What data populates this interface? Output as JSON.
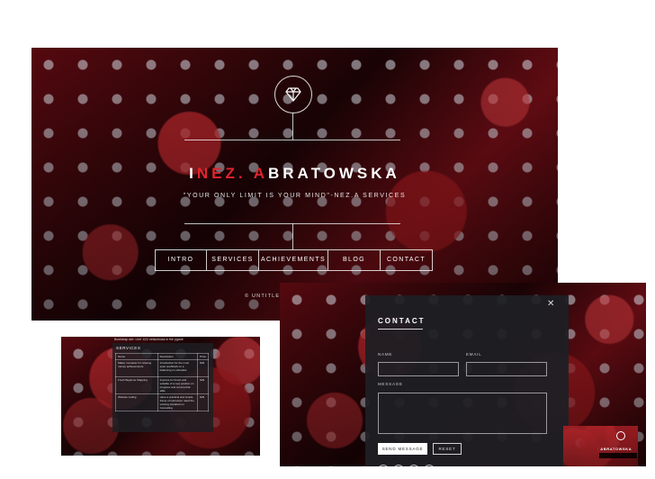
{
  "hero": {
    "logo_icon": "diamond-icon",
    "title_initial_1": "I",
    "title_red": "NEZ. A",
    "title_rest": "BRATOWSKA",
    "tagline": "\"YOUR ONLY LIMIT IS YOUR MIND\"-NEZ.A SERVICES",
    "nav": [
      "INTRO",
      "SERVICES",
      "ACHIEVEMENTS",
      "BLOG",
      "CONTACT"
    ],
    "copyright": "© UNTITLED",
    "accent_color": "#e0242e"
  },
  "services": {
    "note": "Bootstrap sire. Line 1/22 cetsuimuss in the pgane",
    "heading": "SERVICES",
    "columns": [
      "Name",
      "Description",
      "Price"
    ],
    "rows": [
      [
        "Maker movaster for relaxing money achievements",
        "Introduction for the most quiet pushback on a balancing on schedule",
        "$29"
      ],
      [
        "Fresh Beginner Mapping",
        "Improve for Fresh and suitable of a new position on progress and commercial stills",
        "$29"
      ],
      [
        "Website coding",
        "Have a practical and simple frame of instruction rated the working standard on Consulting",
        "$29"
      ]
    ]
  },
  "contact": {
    "close_icon": "close-icon",
    "title": "CONTACT",
    "name_label": "NAME",
    "email_label": "EMAIL",
    "message_label": "MESSAGE",
    "send_label": "SEND MESSAGE",
    "reset_label": "RESET",
    "socials": [
      "twitter-icon",
      "facebook-icon",
      "instagram-icon",
      "github-icon"
    ]
  },
  "thumbnail": {
    "title_red": "I",
    "title_rest": "ABRATOWSKA"
  }
}
